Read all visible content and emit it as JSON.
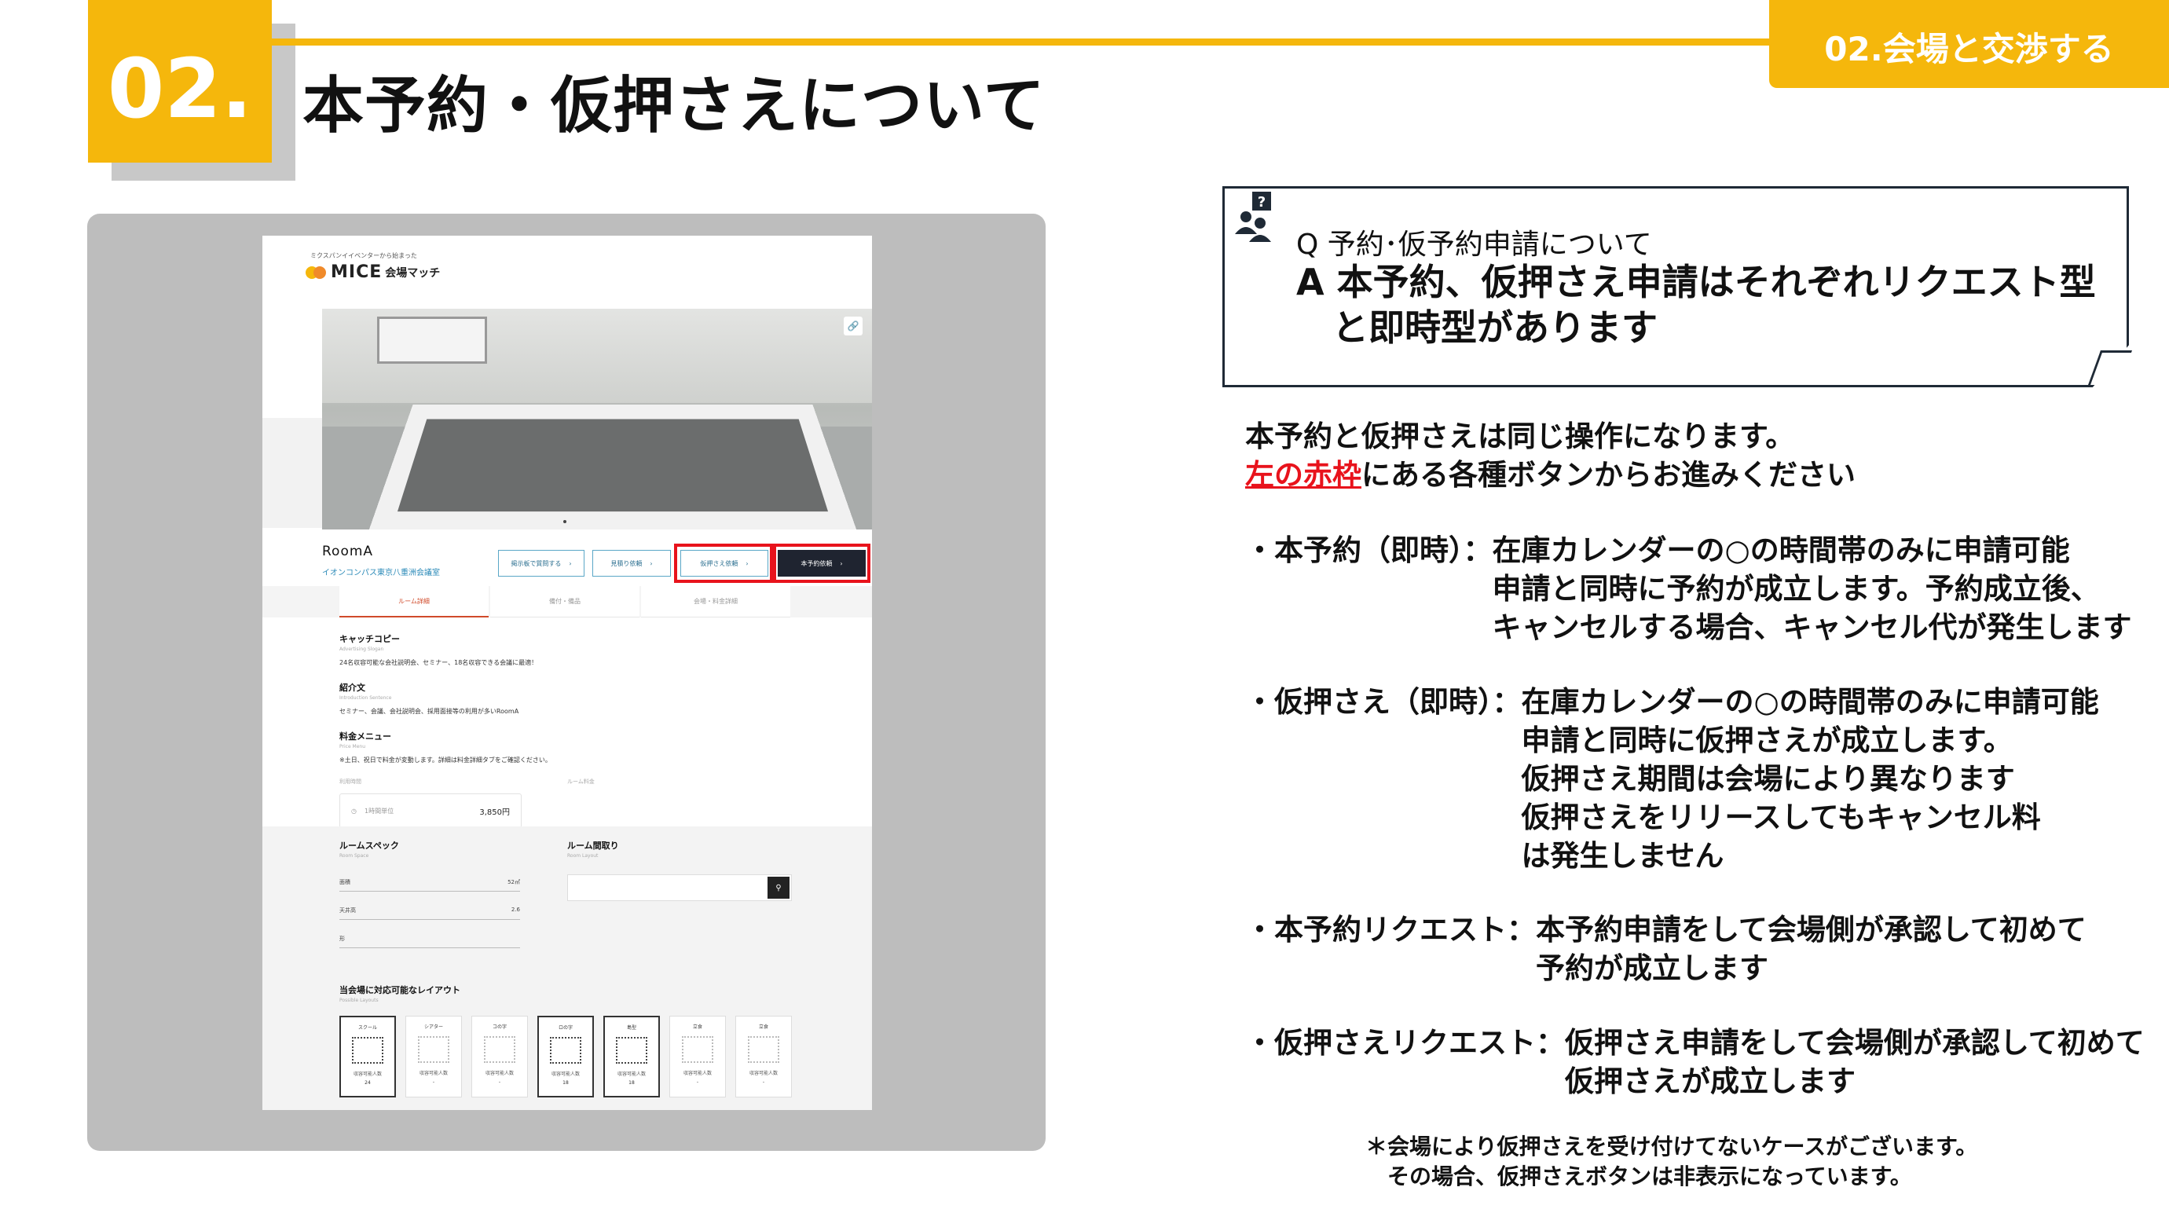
{
  "header": {
    "number": "02.",
    "title": "本予約・仮押さえについて",
    "corner_tab": "02.会場と交渉する"
  },
  "site": {
    "logo_tagline": "ミクスパンイイベンターから始まった",
    "logo_text": "MICE",
    "logo_sub": "会場マッチ",
    "room_name": "RoomA",
    "venue_name": "イオンコンパス東京八重洲会議室",
    "buttons": {
      "ask": "掲示板で質問する",
      "estimate": "見積り依頼",
      "hold": "仮押さえ依頼",
      "reserve": "本予約依頼"
    },
    "tabs": [
      "ルーム詳細",
      "備付・備品",
      "会場・料金詳細"
    ],
    "catch_copy_h": "キャッチコピー",
    "catch_copy_s": "Advertising Slogan",
    "catch_copy_t": "24名収容可能な会社説明会、セミナー、18名収容できる会議に最適！",
    "intro_h": "紹介文",
    "intro_s": "Introduction Sentence",
    "intro_t": "セミナー、会議、会社説明会、採用面接等の利用が多いRoomA",
    "price_h": "料金メニュー",
    "price_s": "Price Menu",
    "price_t": "※土日、祝日で料金が変動します。詳細は料金詳細タブをご確認ください。",
    "price_label_left": "利用時間",
    "price_label_right": "ルーム料金",
    "price_card_label": "1時間単位",
    "price_card_value": "3,850円",
    "spec_h": "ルームスペック",
    "spec_s": "Room Space",
    "spec_rows": [
      {
        "label": "面積",
        "value": "52㎡"
      },
      {
        "label": "天井高",
        "value": "2.6"
      },
      {
        "label": "形",
        "value": ""
      }
    ],
    "layout_h": "ルーム間取り",
    "layout_s": "Room Layout",
    "layouts_h": "当会場に対応可能なレイアウト",
    "layouts_s": "Possible Layouts",
    "layout_cards": [
      {
        "name": "スクール",
        "cap_label": "収容可能人数",
        "cap": "24",
        "active": true
      },
      {
        "name": "シアター",
        "cap_label": "収容可能人数",
        "cap": "-",
        "active": false
      },
      {
        "name": "コの字",
        "cap_label": "収容可能人数",
        "cap": "-",
        "active": false
      },
      {
        "name": "ロの字",
        "cap_label": "収容可能人数",
        "cap": "18",
        "active": true
      },
      {
        "name": "島型",
        "cap_label": "収容可能人数",
        "cap": "18",
        "active": true
      },
      {
        "name": "立食",
        "cap_label": "収容可能人数",
        "cap": "-",
        "active": false
      },
      {
        "name": "立食",
        "cap_label": "収容可能人数",
        "cap": "-",
        "active": false
      }
    ]
  },
  "qa": {
    "q": "Q 予約･仮予約申請について",
    "a_line1": "A 本予約、仮押さえ申請はそれぞれリクエスト型",
    "a_line2": "　と即時型があります"
  },
  "body": {
    "line1": "本予約と仮押さえは同じ操作になります。",
    "line2_red": "左の赤枠",
    "line2_rest": "にある各種ボタンからお進みください"
  },
  "items": [
    {
      "key": "・本予約（即時）：",
      "value": "在庫カレンダーの○の時間帯のみに申請可能\n申請と同時に予約が成立します。予約成立後、\nキャンセルする場合、キャンセル代が発生します"
    },
    {
      "key": "・仮押さえ（即時）：",
      "value": "在庫カレンダーの○の時間帯のみに申請可能\n申請と同時に仮押さえが成立します。\n仮押さえ期間は会場により異なります\n仮押さえをリリースしてもキャンセル料\nは発生しません"
    },
    {
      "key": "・本予約リクエスト：",
      "value": "本予約申請をして会場側が承認して初めて\n予約が成立します"
    },
    {
      "key": "・仮押さえリクエスト：",
      "value": "仮押さえ申請をして会場側が承認して初めて\n仮押さえが成立します"
    }
  ],
  "note": {
    "line1": "＊会場により仮押さえを受け付けてないケースがございます。",
    "line2": "　その場合、仮押さえボタンは非表示になっています。"
  },
  "colors": {
    "accent": "#f5b70c",
    "highlight_red": "#e8131c",
    "navy": "#1f2a36"
  }
}
